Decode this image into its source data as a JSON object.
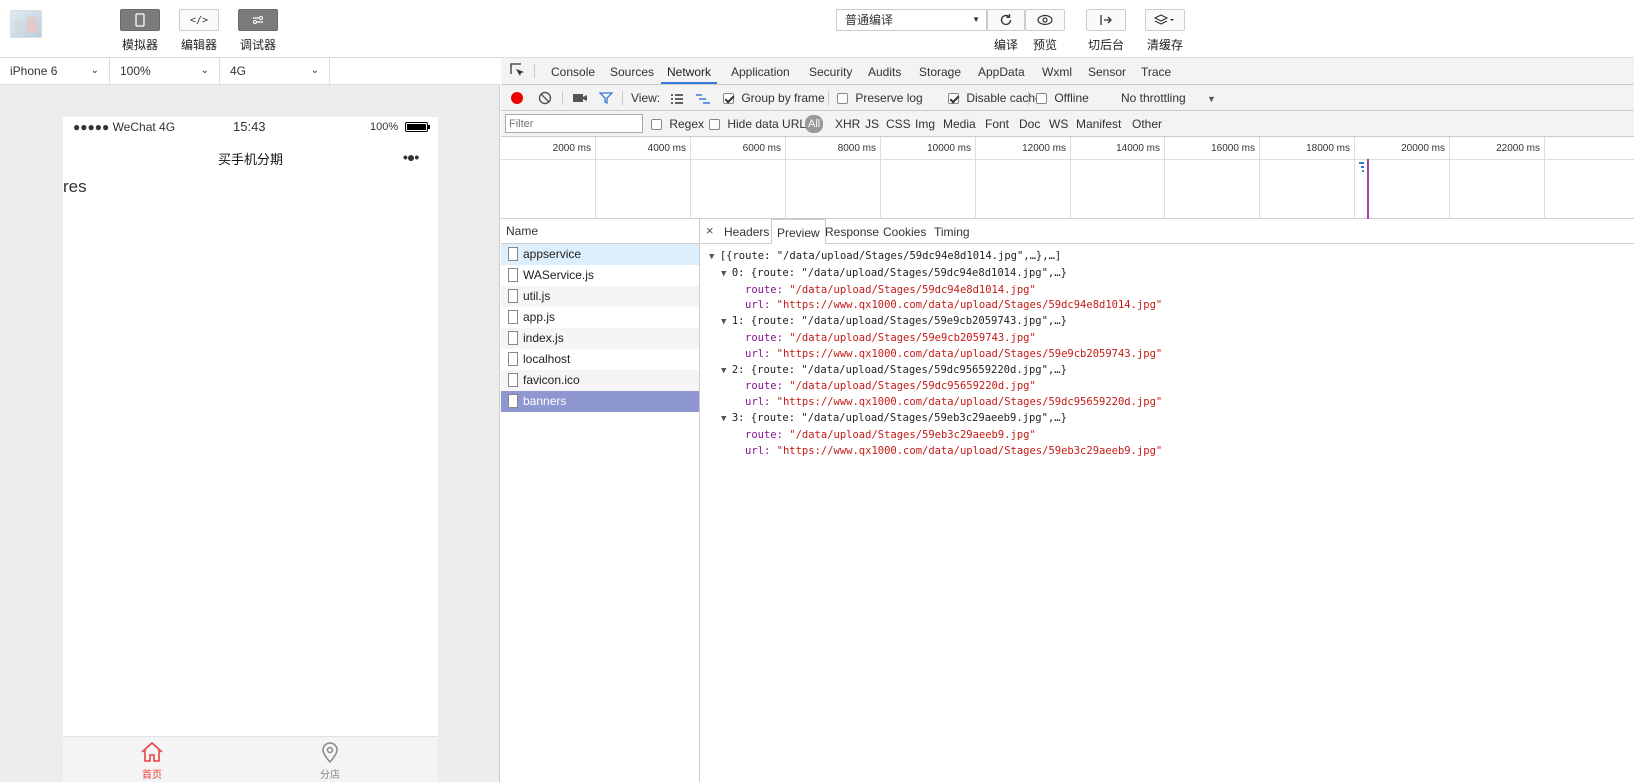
{
  "toolbar": {
    "simulator_label": "模拟器",
    "editor_label": "编辑器",
    "debugger_label": "调试器",
    "compile_mode": "普通编译",
    "compile_label": "编译",
    "preview_label": "预览",
    "background_label": "切后台",
    "clear_cache_label": "清缓存"
  },
  "device": {
    "model": "iPhone 6",
    "zoom": "100%",
    "network": "4G"
  },
  "phone": {
    "carrier": "●●●●● WeChat 4G",
    "time": "15:43",
    "battery": "100%",
    "page_title": "买手机分期",
    "more": "•●•",
    "body_text": "res",
    "tabs": [
      {
        "label": "首页",
        "active": true
      },
      {
        "label": "分店",
        "active": false
      }
    ],
    "accent_color": "#e64340"
  },
  "devtools": {
    "tabs": [
      "Console",
      "Sources",
      "Network",
      "Application",
      "Security",
      "Audits",
      "Storage",
      "AppData",
      "Wxml",
      "Sensor",
      "Trace"
    ],
    "active_tab": "Network",
    "view_label": "View:",
    "group_by_frame": "Group by frame",
    "preserve_log": "Preserve log",
    "disable_cache": "Disable cache",
    "offline": "Offline",
    "throttling": "No throttling",
    "filter_placeholder": "Filter",
    "regex": "Regex",
    "hide_data_urls": "Hide data URLs",
    "type_filters": [
      "All",
      "XHR",
      "JS",
      "CSS",
      "Img",
      "Media",
      "Font",
      "Doc",
      "WS",
      "Manifest",
      "Other"
    ],
    "timeline_ticks": [
      "2000 ms",
      "4000 ms",
      "6000 ms",
      "8000 ms",
      "10000 ms",
      "12000 ms",
      "14000 ms",
      "16000 ms",
      "18000 ms",
      "20000 ms",
      "22000 ms"
    ],
    "name_header": "Name",
    "requests": [
      "appservice",
      "WAService.js",
      "util.js",
      "app.js",
      "index.js",
      "localhost",
      "favicon.ico",
      "banners"
    ],
    "selected_request": "banners",
    "detail_tabs": [
      "Headers",
      "Preview",
      "Response",
      "Cookies",
      "Timing"
    ],
    "active_detail_tab": "Preview",
    "preview": {
      "summary": "[{route: \"/data/upload/Stages/59dc94e8d1014.jpg\",…},…]",
      "items": [
        {
          "summary": "0: {route: \"/data/upload/Stages/59dc94e8d1014.jpg\",…}",
          "route": "\"/data/upload/Stages/59dc94e8d1014.jpg\"",
          "url": "\"https://www.qx1000.com/data/upload/Stages/59dc94e8d1014.jpg\""
        },
        {
          "summary": "1: {route: \"/data/upload/Stages/59e9cb2059743.jpg\",…}",
          "route": "\"/data/upload/Stages/59e9cb2059743.jpg\"",
          "url": "\"https://www.qx1000.com/data/upload/Stages/59e9cb2059743.jpg\""
        },
        {
          "summary": "2: {route: \"/data/upload/Stages/59dc95659220d.jpg\",…}",
          "route": "\"/data/upload/Stages/59dc95659220d.jpg\"",
          "url": "\"https://www.qx1000.com/data/upload/Stages/59dc95659220d.jpg\""
        },
        {
          "summary": "3: {route: \"/data/upload/Stages/59eb3c29aeeb9.jpg\",…}",
          "route": "\"/data/upload/Stages/59eb3c29aeeb9.jpg\"",
          "url": "\"https://www.qx1000.com/data/upload/Stages/59eb3c29aeeb9.jpg\""
        }
      ],
      "route_key": "route:",
      "url_key": "url:"
    }
  }
}
